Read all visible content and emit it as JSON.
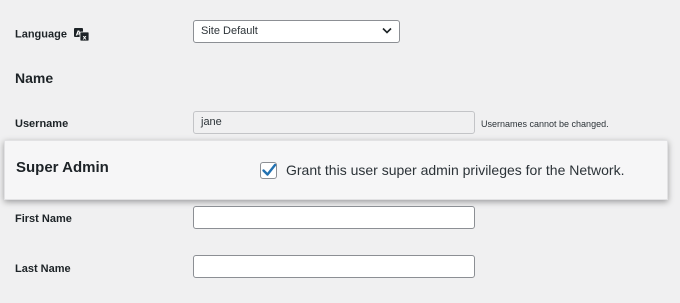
{
  "language": {
    "label": "Language",
    "selected": "Site Default"
  },
  "name_section": {
    "heading": "Name"
  },
  "username": {
    "label": "Username",
    "value": "jane",
    "note": "Usernames cannot be changed."
  },
  "super_admin": {
    "label": "Super Admin",
    "checked": true,
    "checkbox_label": "Grant this user super admin privileges for the Network."
  },
  "first_name": {
    "label": "First Name",
    "value": ""
  },
  "last_name": {
    "label": "Last Name",
    "value": ""
  },
  "colors": {
    "checkmark": "#2271b1"
  }
}
